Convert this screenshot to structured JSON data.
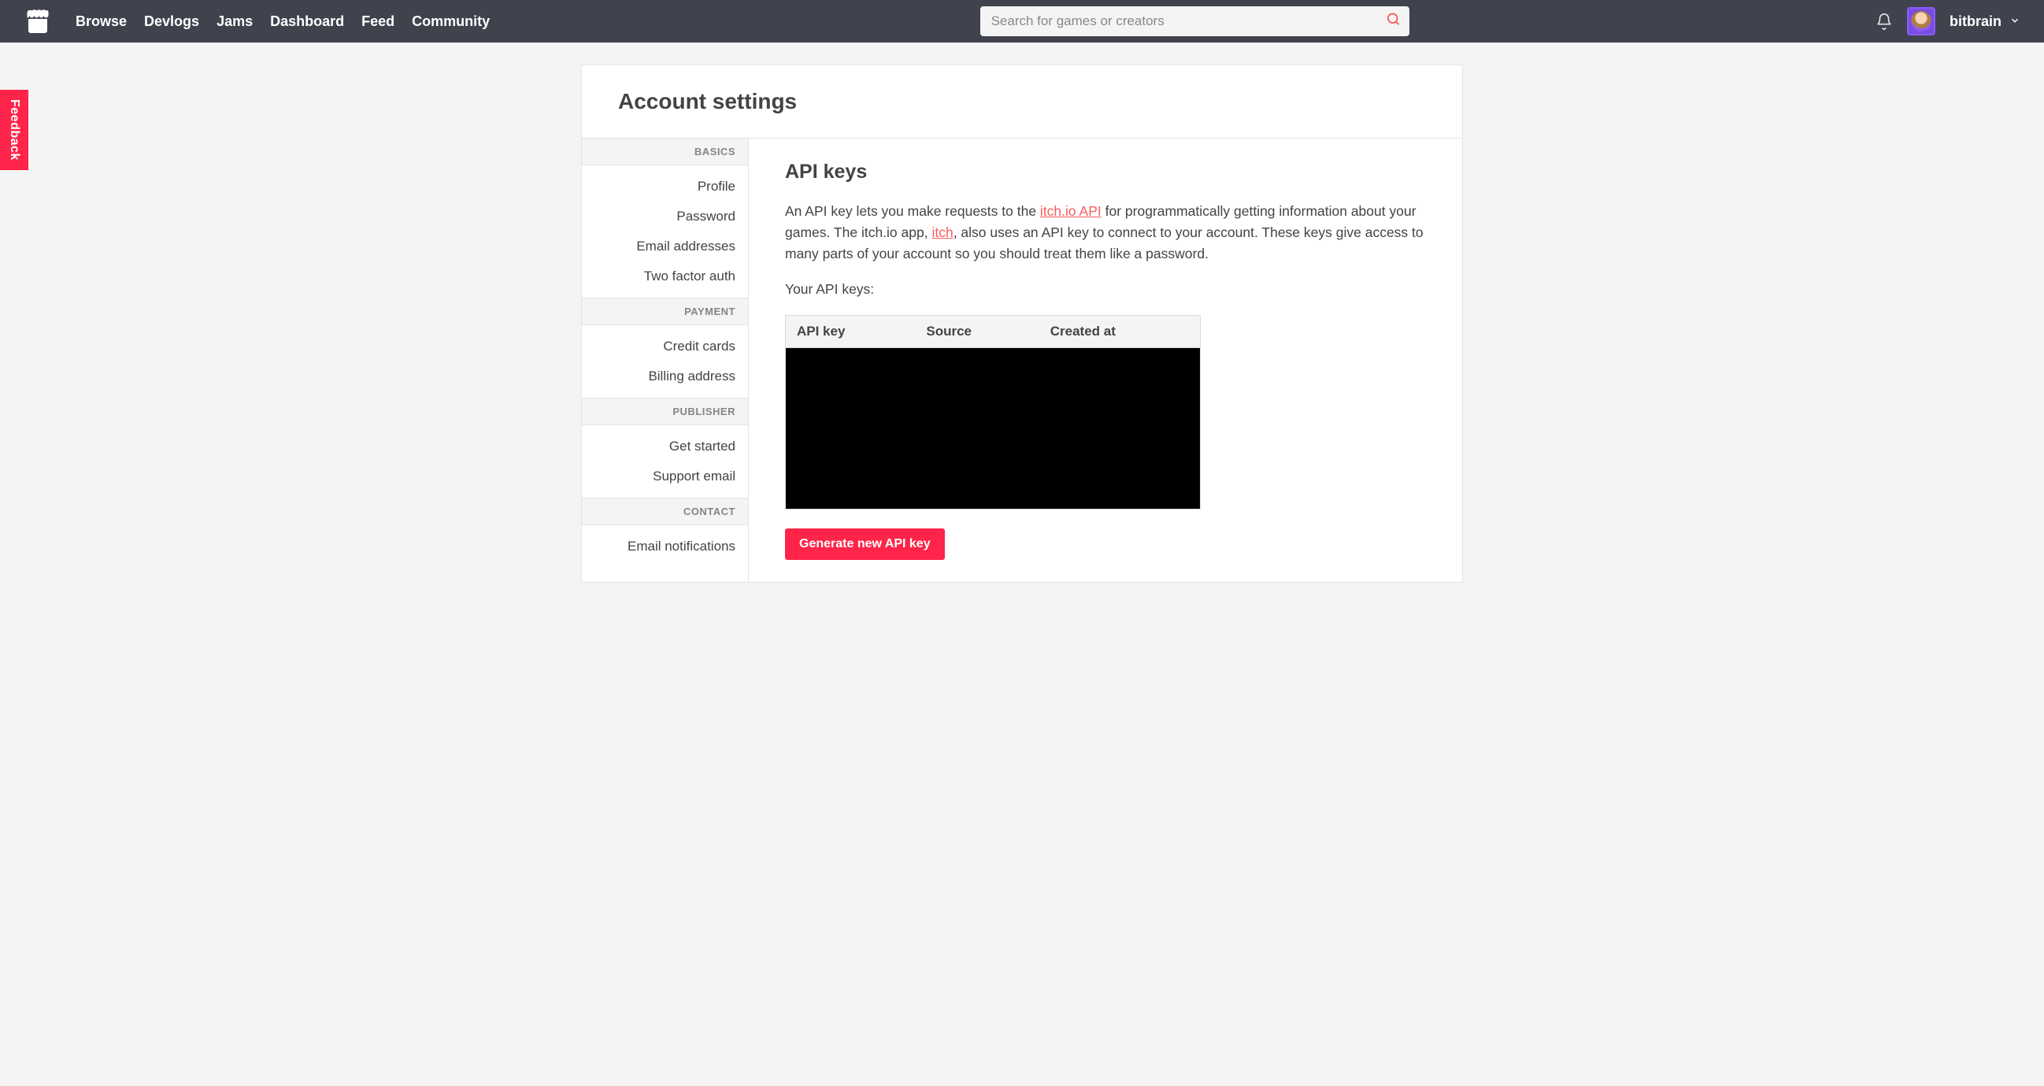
{
  "nav": {
    "links": [
      "Browse",
      "Devlogs",
      "Jams",
      "Dashboard",
      "Feed",
      "Community"
    ],
    "search_placeholder": "Search for games or creators",
    "username": "bitbrain"
  },
  "feedback_label": "Feedback",
  "page_title": "Account settings",
  "sidebar": {
    "sections": [
      {
        "header": "BASICS",
        "items": [
          "Profile",
          "Password",
          "Email addresses",
          "Two factor auth"
        ]
      },
      {
        "header": "PAYMENT",
        "items": [
          "Credit cards",
          "Billing address"
        ]
      },
      {
        "header": "PUBLISHER",
        "items": [
          "Get started",
          "Support email"
        ]
      },
      {
        "header": "CONTACT",
        "items": [
          "Email notifications"
        ]
      }
    ]
  },
  "main": {
    "heading": "API keys",
    "intro_before_link1": "An API key lets you make requests to the ",
    "link1": "itch.io API",
    "intro_mid": " for programmatically getting information about your games. The itch.io app, ",
    "link2": "itch",
    "intro_after_link2": ", also uses an API key to connect to your account. These keys give access to many parts of your account so you should treat them like a password.",
    "your_keys_label": "Your API keys:",
    "table": {
      "columns": [
        "API key",
        "Source",
        "Created at"
      ]
    },
    "generate_button": "Generate new API key"
  }
}
